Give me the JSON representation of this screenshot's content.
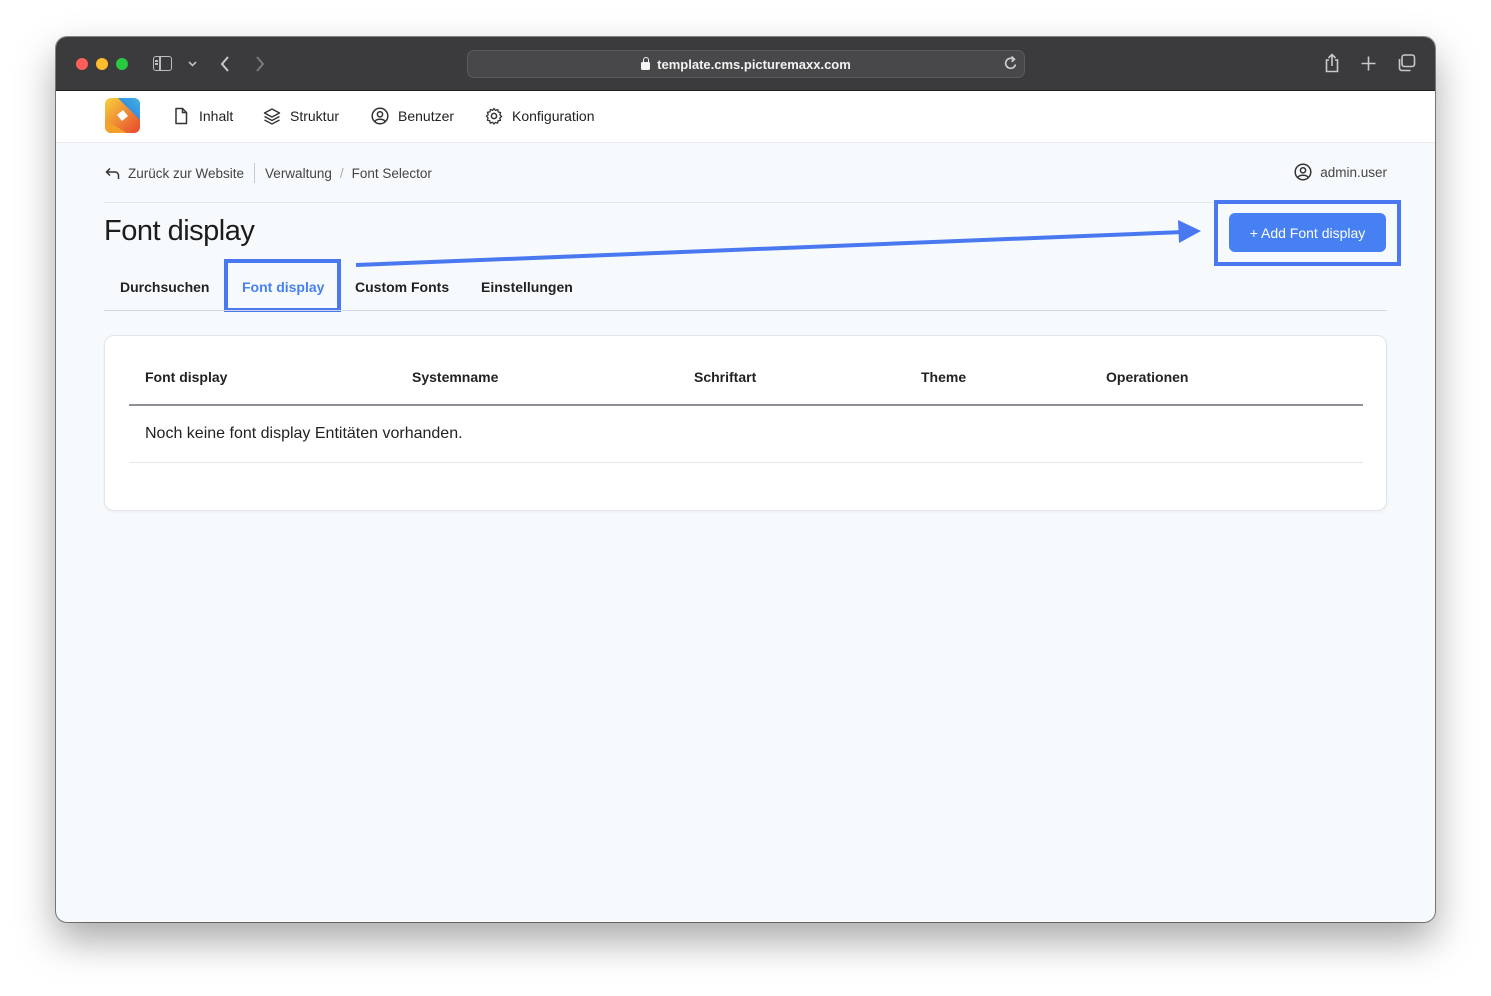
{
  "browser": {
    "url": "template.cms.picturemaxx.com"
  },
  "nav": {
    "items": [
      {
        "label": "Inhalt",
        "icon": "document-icon"
      },
      {
        "label": "Struktur",
        "icon": "layers-icon"
      },
      {
        "label": "Benutzer",
        "icon": "user-circle-icon"
      },
      {
        "label": "Konfiguration",
        "icon": "gear-icon"
      }
    ]
  },
  "breadcrumb": {
    "back_label": "Zurück zur Website",
    "items": [
      "Verwaltung",
      "Font Selector"
    ]
  },
  "user": {
    "name": "admin.user"
  },
  "page": {
    "title": "Font display",
    "add_button": "+ Add Font display"
  },
  "tabs": [
    {
      "label": "Durchsuchen",
      "active": false
    },
    {
      "label": "Font display",
      "active": true
    },
    {
      "label": "Custom Fonts",
      "active": false
    },
    {
      "label": "Einstellungen",
      "active": false
    }
  ],
  "table": {
    "columns": [
      "Font display",
      "Systemname",
      "Schriftart",
      "Theme",
      "Operationen"
    ],
    "empty_message": "Noch keine font display Entitäten vorhanden."
  },
  "colors": {
    "accent": "#4680f2",
    "annotation": "#4a78f0"
  }
}
